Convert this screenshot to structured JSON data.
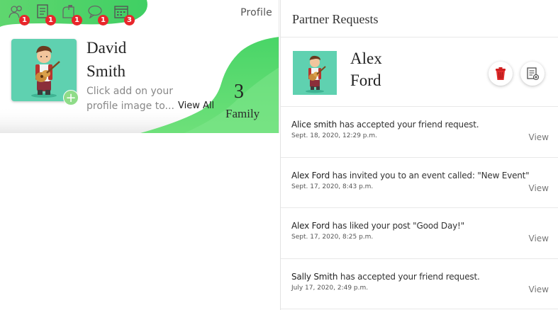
{
  "profile": {
    "link_label": "Profile",
    "first_name": "David",
    "last_name": "Smith",
    "hint": "Click add on your profile image to...",
    "view_all": "View All",
    "family_count": "3",
    "family_label": "Family",
    "add_icon": "+"
  },
  "topbar": {
    "icons": [
      {
        "name": "friends-icon",
        "badge": "1"
      },
      {
        "name": "document-icon",
        "badge": "1"
      },
      {
        "name": "mailbox-icon",
        "badge": "1"
      },
      {
        "name": "chat-icon",
        "badge": "1"
      },
      {
        "name": "calendar-icon",
        "badge": "3"
      }
    ]
  },
  "panel": {
    "title": "Partner Requests",
    "partner": {
      "first": "Alex",
      "last": "Ford",
      "delete_icon": "trash-icon",
      "details_icon": "list-view-icon"
    },
    "notifications": [
      {
        "actor": "Alice smith",
        "message": " has accepted your friend request.",
        "time": "Sept. 18, 2020, 12:29 p.m.",
        "action": "View"
      },
      {
        "actor": "Alex Ford",
        "message": " has invited you to an event called: \"New Event\"",
        "time": "Sept. 17, 2020, 8:43 p.m.",
        "action": "View"
      },
      {
        "actor": "Alex Ford",
        "message": " has liked your post \"Good Day!\"",
        "time": "Sept. 17, 2020, 8:25 p.m.",
        "action": "View"
      },
      {
        "actor": "Sally Smith",
        "message": " has accepted your friend request.",
        "time": "July 17, 2020, 2:49 p.m.",
        "action": "View"
      }
    ]
  },
  "colors": {
    "brand_green": "#4ed06a",
    "badge_red": "#e8262b",
    "avatar_bg": "#5fd1b0"
  }
}
